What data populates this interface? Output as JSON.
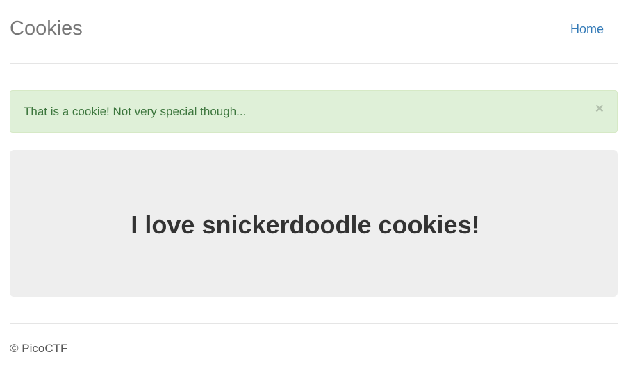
{
  "header": {
    "brand": "Cookies",
    "nav": [
      {
        "label": "Home"
      }
    ]
  },
  "alert": {
    "message": "That is a cookie! Not very special though...",
    "close_symbol": "×",
    "close_icon": "close-icon"
  },
  "jumbotron": {
    "heading": "I love snickerdoodle cookies!"
  },
  "footer": {
    "text": "© PicoCTF"
  },
  "colors": {
    "link": "#337ab7",
    "alert_bg": "#dff0d8",
    "alert_text": "#3c763d",
    "jumbotron_bg": "#eeeeee"
  }
}
